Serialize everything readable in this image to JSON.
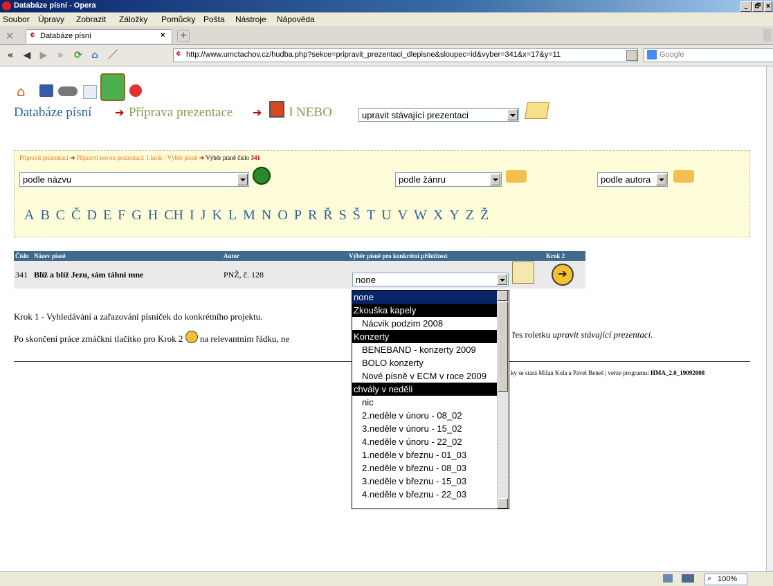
{
  "window": {
    "title": "Databáze písní - Opera",
    "minimize": "_",
    "maximize": "🗗",
    "close": "x"
  },
  "menu": [
    "Soubor",
    "Úpravy",
    "Zobrazit",
    "Záložky",
    "Pomůcky",
    "Pošta",
    "Nástroje",
    "Nápověda"
  ],
  "tab": {
    "label": "Databáze písní",
    "close": "×",
    "new": "+"
  },
  "address": {
    "url": "http://www.umctachov.cz/hudba.php?sekce=pripravit_prezentaci_dlepisne&sloupec=id&vyber=341&x=17&y=11",
    "search_placeholder": "Google"
  },
  "header": {
    "crumb1": "Databáze písní",
    "crumb2": "Příprava prezentace",
    "sep": "‖ NEBO",
    "select_value": "upravit stávající prezentaci"
  },
  "filter": {
    "crumb_a": "Připravit prezentaci",
    "crumb_b": "Připravit novou prezentaci: 1.krok - Výběr písně",
    "crumb_c": "Výběr písně číslo",
    "crumb_num": "341",
    "by_name": "podle názvu",
    "by_genre": "podle žánru",
    "by_author": "podle autora",
    "letters": [
      "A",
      "B",
      "C",
      "Č",
      "D",
      "E",
      "F",
      "G",
      "H",
      "CH",
      "I",
      "J",
      "K",
      "L",
      "M",
      "N",
      "O",
      "P",
      "R",
      "Ř",
      "S",
      "Š",
      "T",
      "U",
      "V",
      "W",
      "X",
      "Y",
      "Z",
      "Ž"
    ]
  },
  "table": {
    "headers": [
      "Číslo",
      "Název písně",
      "Autor",
      "Výběr písně pro konkrétní příležitost",
      "Krok 2"
    ],
    "row": {
      "num": "341",
      "title": "Blíž a blíž Jezu, sám táhni mne",
      "author": "PNŽ, č. 128",
      "select_value": "none"
    }
  },
  "text": {
    "krok1": "Krok 1 - Vyhledávání a zařazování písniček do konkrétního projektu.",
    "line2_a": "Po skončení práce zmáčkni tlačítko pro Krok 2",
    "line2_b": "na relevantním řádku, ne",
    "line2_c": "řes roletku",
    "line2_d": "upravit stávající prezentaci.",
    "footer_a": "ky se stará Milan Kola a Pavel Beneš | verze programu:",
    "footer_b": "HMA_2.0_19092008"
  },
  "dropdown": [
    {
      "label": "none",
      "kind": "selected"
    },
    {
      "label": "Zkouška kapely",
      "kind": "group"
    },
    {
      "label": "Nácvik podzim 2008",
      "kind": "option"
    },
    {
      "label": "Konzerty",
      "kind": "group"
    },
    {
      "label": "BENEBAND - konzerty 2009",
      "kind": "option"
    },
    {
      "label": "BOLO konzerty",
      "kind": "option"
    },
    {
      "label": "Nové písně v ECM v roce 2009",
      "kind": "option"
    },
    {
      "label": "chvály v neděli",
      "kind": "group"
    },
    {
      "label": "nic",
      "kind": "option"
    },
    {
      "label": "2.neděle v únoru - 08_02",
      "kind": "option"
    },
    {
      "label": "3.neděle v únoru - 15_02",
      "kind": "option"
    },
    {
      "label": "4.neděle v únoru - 22_02",
      "kind": "option"
    },
    {
      "label": "1.neděle v březnu - 01_03",
      "kind": "option"
    },
    {
      "label": "2.neděle v březnu - 08_03",
      "kind": "option"
    },
    {
      "label": "3.neděle v březnu - 15_03",
      "kind": "option"
    },
    {
      "label": "4.neděle v březnu - 22_03",
      "kind": "option"
    }
  ],
  "status": {
    "zoom": "100%"
  },
  "colors": {
    "link": "#2a6496",
    "accent_red": "#c00000",
    "filter_bg": "#fffcd9",
    "table_header": "#3f6a8c"
  }
}
